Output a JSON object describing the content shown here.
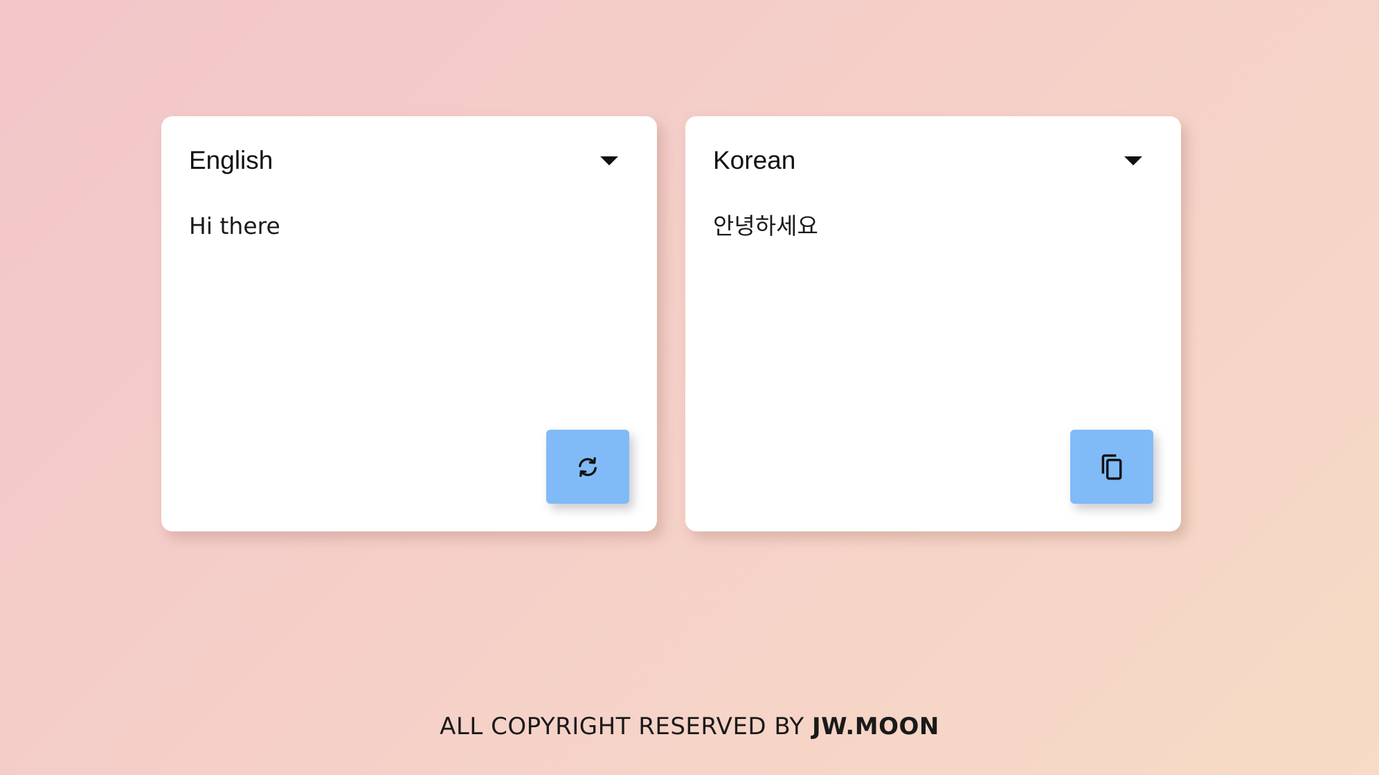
{
  "source_panel": {
    "language": "English",
    "text": "Hi there",
    "action_icon": "refresh-icon"
  },
  "target_panel": {
    "language": "Korean",
    "text": "안녕하세요",
    "action_icon": "copy-icon"
  },
  "footer": {
    "prefix": "ALL COPYRIGHT RESERVED BY ",
    "author": "JW.MOON"
  },
  "colors": {
    "button": "#80bbf7",
    "background_start": "#f3c6c9",
    "background_end": "#f7dbc6"
  }
}
